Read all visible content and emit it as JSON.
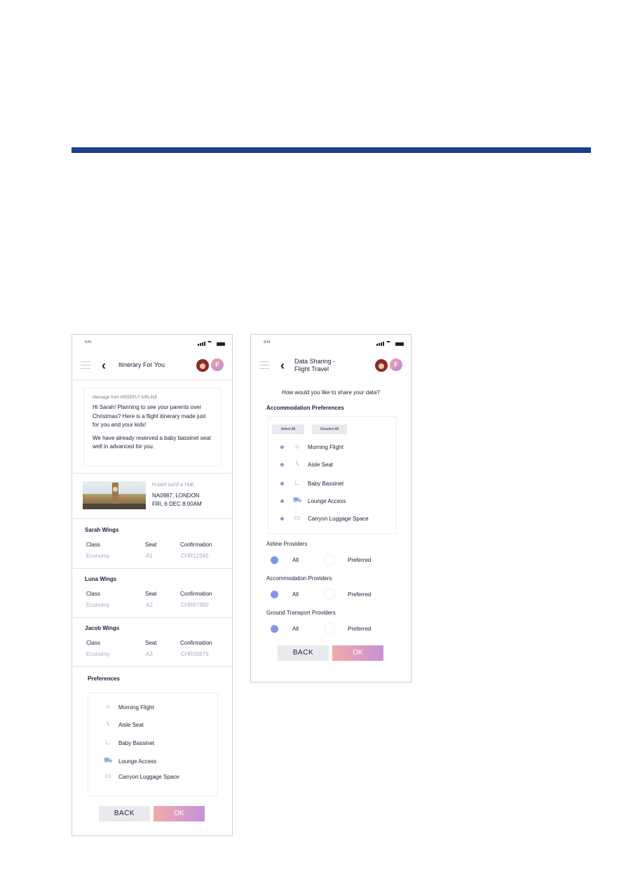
{
  "colors": {
    "brand_bar": "#1a3f8c",
    "accent": "#7f98e0",
    "ok_gradient_start": "#f2a9a7",
    "ok_gradient_end": "#c792d6"
  },
  "screen1": {
    "status_time": "9:41",
    "title": "Itinerary For You",
    "message": {
      "from": "Message from WEEEFLY AIRLINE",
      "line1": "Hi Sarah! Planning to see your parents over Christmas? Here is a flight itinerary made just for you and your kids!",
      "line2": "We have already reserved a baby bassinet seat well in advanced for you."
    },
    "flight": {
      "label": "FLIGHT DATE & TIME",
      "code": "NA0987, LONDON",
      "date": "FRI, 6 DEC 8:00AM"
    },
    "columns": {
      "class": "Class",
      "seat": "Seat",
      "confirmation": "Confirmation"
    },
    "passengers": [
      {
        "name": "Sarah Wings",
        "class": "Economy",
        "seat": "A1",
        "confirmation": "CHR12345"
      },
      {
        "name": "Luna Wings",
        "class": "Economy",
        "seat": "A2",
        "confirmation": "CHR67890"
      },
      {
        "name": "Jacob Wings",
        "class": "Economy",
        "seat": "A3",
        "confirmation": "CHR09876"
      }
    ],
    "preferences_title": "Preferences",
    "preferences": [
      {
        "label": "Morning Flight",
        "icon": "sun-icon"
      },
      {
        "label": "Aisle Seat",
        "icon": "seat-icon"
      },
      {
        "label": "Baby Bassinet",
        "icon": "bassinet-icon"
      },
      {
        "label": "Lounge Access",
        "icon": "lounge-icon"
      },
      {
        "label": "Carryon Luggage Space",
        "icon": "luggage-icon"
      }
    ],
    "back": "BACK",
    "ok": "OK"
  },
  "screen2": {
    "status_time": "9:41",
    "title_line1": "Data Sharing -",
    "title_line2": "Flight Travel",
    "question": "How would you like to share your data?",
    "accommodation_title": "Accommodation Preferences",
    "select_all": "Select All",
    "deselect_all": "Deselect All",
    "items": [
      {
        "label": "Morning Flight",
        "icon": "sun-icon"
      },
      {
        "label": "Aisle Seat",
        "icon": "seat-icon"
      },
      {
        "label": "Baby Bassinet",
        "icon": "bassinet-icon"
      },
      {
        "label": "Lounge Access",
        "icon": "lounge-icon"
      },
      {
        "label": "Carryon Luggage Space",
        "icon": "luggage-icon"
      }
    ],
    "groups": [
      {
        "title": "Airline Providers",
        "all": "All",
        "preferred": "Preferred",
        "selected": "All"
      },
      {
        "title": "Accommodation Providers",
        "all": "All",
        "preferred": "Preferred",
        "selected": "All"
      },
      {
        "title": "Ground Transport Providers",
        "all": "All",
        "preferred": "Preferred",
        "selected": "All"
      }
    ],
    "back": "BACK",
    "ok": "OK"
  }
}
